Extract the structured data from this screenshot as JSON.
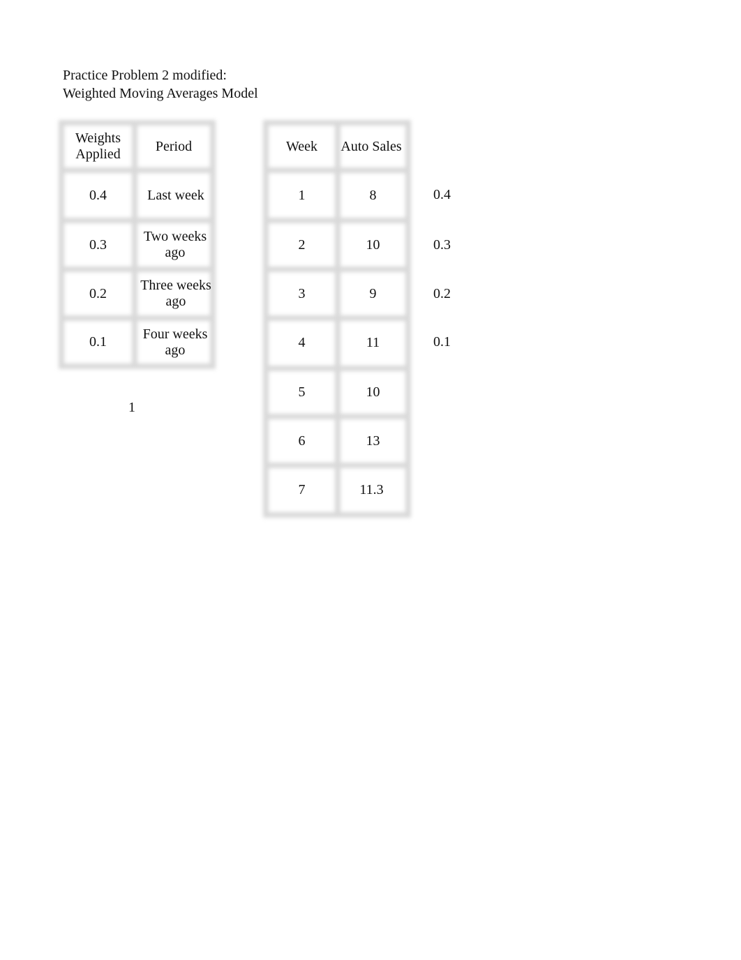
{
  "title": {
    "line1": "Practice Problem 2 modified:",
    "line2": "Weighted Moving Averages Model"
  },
  "weights_table": {
    "headers": [
      "Weights Applied",
      "Period"
    ],
    "header_lines": [
      [
        "Weights",
        "Applied"
      ],
      [
        "Period"
      ]
    ],
    "rows": [
      {
        "weight": "0.4",
        "period_lines": [
          "Last week"
        ]
      },
      {
        "weight": "0.3",
        "period_lines": [
          "Two weeks",
          "ago"
        ]
      },
      {
        "weight": "0.2",
        "period_lines": [
          "Three weeks",
          "ago"
        ]
      },
      {
        "weight": "0.1",
        "period_lines": [
          "Four weeks",
          "ago"
        ]
      }
    ],
    "sum": "1"
  },
  "sales_table": {
    "headers": [
      "Week",
      "Auto Sales"
    ],
    "rows": [
      {
        "week": "1",
        "sales": "8",
        "weight": "0.4"
      },
      {
        "week": "2",
        "sales": "10",
        "weight": "0.3"
      },
      {
        "week": "3",
        "sales": "9",
        "weight": "0.2"
      },
      {
        "week": "4",
        "sales": "11",
        "weight": "0.1"
      },
      {
        "week": "5",
        "sales": "10"
      },
      {
        "week": "6",
        "sales": "13"
      },
      {
        "week": "7",
        "sales": "11.3"
      }
    ]
  }
}
